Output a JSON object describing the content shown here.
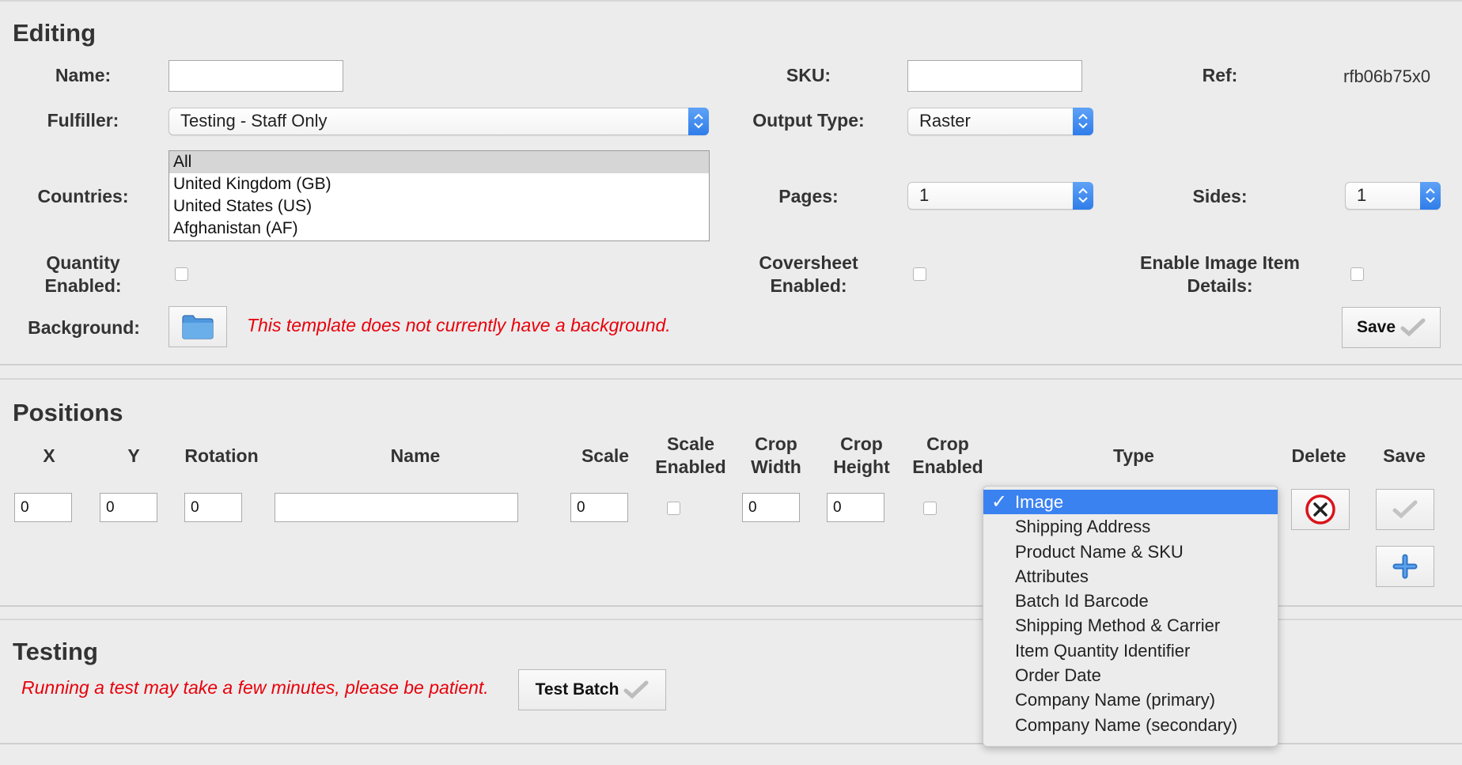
{
  "editing": {
    "title": "Editing",
    "name_label": "Name:",
    "name_value": "",
    "sku_label": "SKU:",
    "sku_value": "",
    "ref_label": "Ref:",
    "ref_value": "rfb06b75x0",
    "fulfiller_label": "Fulfiller:",
    "fulfiller_value": "Testing - Staff Only",
    "output_type_label": "Output Type:",
    "output_type_value": "Raster",
    "countries_label": "Countries:",
    "countries_options": [
      "All",
      "United Kingdom (GB)",
      "United States (US)",
      "Afghanistan (AF)"
    ],
    "pages_label": "Pages:",
    "pages_value": "1",
    "sides_label": "Sides:",
    "sides_value": "1",
    "quantity_enabled_label_1": "Quantity",
    "quantity_enabled_label_2": "Enabled:",
    "coversheet_enabled_label_1": "Coversheet",
    "coversheet_enabled_label_2": "Enabled:",
    "image_item_label_1": "Enable Image Item",
    "image_item_label_2": "Details:",
    "background_label": "Background:",
    "background_message": "This template does not currently have a background.",
    "save_label": "Save"
  },
  "positions": {
    "title": "Positions",
    "headers": {
      "x": "X",
      "y": "Y",
      "rotation": "Rotation",
      "name": "Name",
      "scale": "Scale",
      "scale_enabled_1": "Scale",
      "scale_enabled_2": "Enabled",
      "crop_width_1": "Crop",
      "crop_width_2": "Width",
      "crop_height_1": "Crop",
      "crop_height_2": "Height",
      "crop_enabled_1": "Crop",
      "crop_enabled_2": "Enabled",
      "type": "Type",
      "delete": "Delete",
      "save": "Save"
    },
    "row": {
      "x": "0",
      "y": "0",
      "rotation": "0",
      "name": "",
      "scale": "0",
      "crop_width": "0",
      "crop_height": "0"
    },
    "type_options": [
      "Image",
      "Shipping Address",
      "Product Name & SKU",
      "Attributes",
      "Batch Id Barcode",
      "Shipping Method & Carrier",
      "Item Quantity Identifier",
      "Order Date",
      "Company Name (primary)",
      "Company Name (secondary)"
    ],
    "type_selected_check": "✓"
  },
  "testing": {
    "title": "Testing",
    "message": "Running a test may take a few minutes, please be patient.",
    "test_batch_label": "Test Batch"
  },
  "colors": {
    "warning": "#e8000b",
    "accent": "#3b82f1"
  }
}
